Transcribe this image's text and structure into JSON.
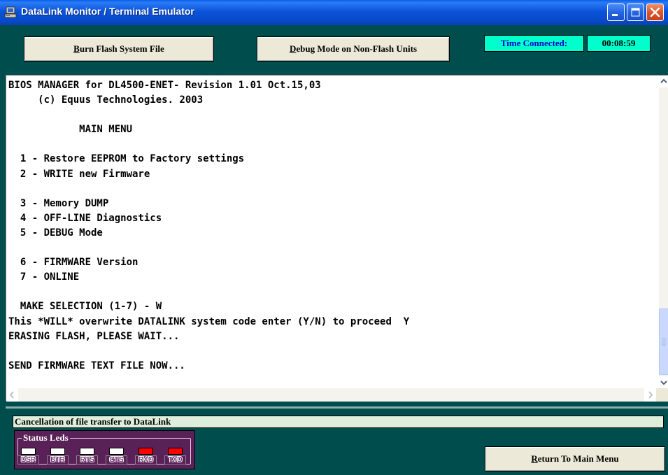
{
  "window": {
    "title": "DataLink Monitor / Terminal Emulator",
    "icon": "terminal-computer-icon",
    "caption_buttons": [
      "minimize-icon",
      "maximize-icon",
      "close-icon"
    ]
  },
  "toolbar": {
    "burn_button": {
      "accel": "B",
      "rest": "urn Flash System File"
    },
    "debug_button": {
      "accel": "D",
      "rest": "ebug Mode on Non-Flash Units"
    },
    "time_label": "Time Connected:",
    "time_value": "00:08:59"
  },
  "terminal": {
    "lines": [
      "BIOS MANAGER for DL4500-ENET- Revision 1.01 Oct.15,03",
      "     (c) Equus Technologies. 2003",
      "",
      "            MAIN MENU",
      "",
      "  1 - Restore EEPROM to Factory settings",
      "  2 - WRITE new Firmware",
      "",
      "  3 - Memory DUMP",
      "  4 - OFF-LINE Diagnostics",
      "  5 - DEBUG Mode",
      "",
      "  6 - FIRMWARE Version",
      "  7 - ONLINE",
      "",
      "  MAKE SELECTION (1-7) - W",
      "This *WILL* overwrite DATALINK system code enter (Y/N) to proceed  Y",
      "ERASING FLASH, PLEASE WAIT...",
      "",
      "SEND FIRMWARE TEXT FILE NOW..."
    ]
  },
  "status": {
    "message": "Cancellation of file transfer to DataLink"
  },
  "status_leds": {
    "title": "Status Leds",
    "leds": [
      {
        "label": "DSR",
        "state": "off",
        "color": "#ffffff"
      },
      {
        "label": "DTR",
        "state": "off",
        "color": "#ffffff"
      },
      {
        "label": "RTS",
        "state": "off",
        "color": "#ffffff"
      },
      {
        "label": "CTS",
        "state": "off",
        "color": "#ffffff"
      },
      {
        "label": "RXD",
        "state": "on",
        "color": "#ff0000"
      },
      {
        "label": "TXD",
        "state": "on",
        "color": "#ff0000"
      }
    ]
  },
  "footer": {
    "return_button": {
      "accel": "R",
      "rest": "eturn To Main Menu"
    }
  },
  "colors": {
    "background": "#004d4d",
    "accent_cyan": "#00ffcc",
    "led_panel": "#5a2058"
  }
}
